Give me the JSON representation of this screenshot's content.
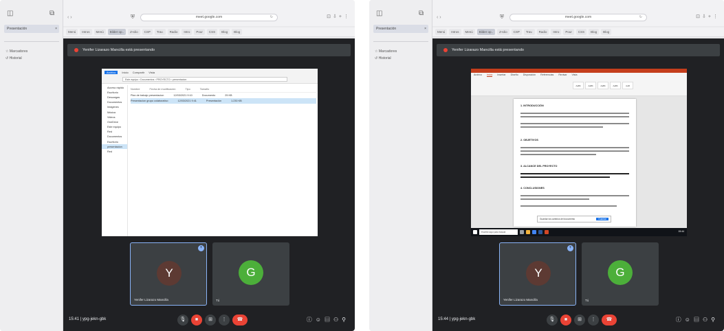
{
  "screens": [
    {
      "sidebar": {
        "tab_label": "Presentación",
        "tab_close": "×",
        "section_label": "",
        "items": [
          "Marcadores",
          "Historial"
        ]
      },
      "browser": {
        "url": "meet.google.com",
        "bookmarks": [
          "Menú",
          "Intros",
          "Menú",
          "Bilder op..",
          "Z-Idio",
          "CSP",
          "Trav.",
          "Radio",
          "Intro",
          "Pour",
          "CSS",
          "Blog",
          "Blog"
        ],
        "selected_bookmark": 3
      },
      "meet": {
        "banner": "Yenifer Lizarazo Mancilla está presentando",
        "shared": "explorer",
        "participants": [
          {
            "initial": "Y",
            "name": "Yenifer Lizarazo Mancilla",
            "color": "#5d3a33",
            "pinned": true
          },
          {
            "initial": "G",
            "name": "Tú",
            "color": "#4caf3a",
            "pinned": false
          }
        ],
        "time": "15:41",
        "meeting_code": "ypg-jekn-gbk"
      }
    },
    {
      "sidebar": {
        "tab_label": "Presentación",
        "tab_close": "×",
        "section_label": "",
        "items": [
          "Marcadores",
          "Historial"
        ]
      },
      "browser": {
        "url": "meet.google.com",
        "bookmarks": [
          "Menú",
          "Intros",
          "Menú",
          "Bilder op..",
          "Z-Idio",
          "CSP",
          "Trav.",
          "Radio",
          "Intro",
          "Pour",
          "CSS",
          "Blog",
          "Blog"
        ],
        "selected_bookmark": 3
      },
      "meet": {
        "banner": "Yenifer Lizarazo Mancilla está presentando",
        "shared": "word",
        "participants": [
          {
            "initial": "Y",
            "name": "Yenifer Lizarazo Mancilla",
            "color": "#5d3a33",
            "pinned": true
          },
          {
            "initial": "G",
            "name": "Tú",
            "color": "#4caf3a",
            "pinned": false
          }
        ],
        "time": "15:44",
        "meeting_code": "ypg-jekn-gbk"
      }
    }
  ],
  "explorer": {
    "ribbon": [
      "Archivo",
      "Inicio",
      "Compartir",
      "Vista"
    ],
    "path": "Este equipo › Documentos › PROYECTO › presentacion",
    "nav": [
      "Acceso rápido",
      "Escritorio",
      "Descargas",
      "Documentos",
      "Imágenes",
      "Música",
      "Videos",
      "OneDrive",
      "Este equipo",
      "Red",
      "Documentos",
      "Escritorio",
      "presentacion",
      "Red"
    ],
    "nav_highlight": 12,
    "columns": [
      "Nombre",
      "Fecha de modificación",
      "Tipo",
      "Tamaño"
    ],
    "rows": [
      [
        "Plan de trabajo presentacion",
        "12/03/2021 9:10",
        "Documento",
        "25 KB"
      ],
      [
        "Presentacion grupo colaborativo",
        "12/03/2021 9:41",
        "Presentación",
        "1.230 KB"
      ]
    ],
    "row_highlight": 1
  },
  "word": {
    "tabs": [
      "Archivo",
      "Inicio",
      "Insertar",
      "Diseño",
      "Disposición",
      "Referencias",
      "Revisar",
      "Vista"
    ],
    "active_tab": 1,
    "headings": [
      "1. INTRODUCCIÓN",
      "2. OBJETIVOS",
      "3. ALCANCE DEL PROYECTO",
      "4. CONCLUSIONES"
    ],
    "popup_text": "Guardar los cambios del documento",
    "popup_button": "Guardar",
    "taskbar_search": "Escribe aquí para buscar",
    "taskbar_time": "15:44"
  },
  "icons": {
    "mic": "mic-icon",
    "cam": "camera-icon",
    "present": "present-icon",
    "more": "more-icon",
    "hangup": "hangup-icon"
  }
}
